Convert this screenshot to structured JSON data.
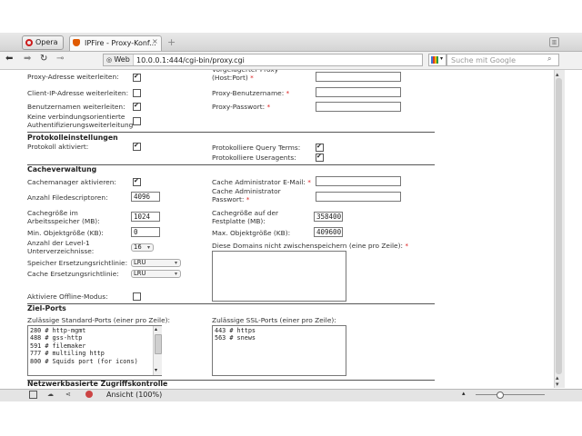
{
  "browser": {
    "opera_label": "Opera",
    "tab_title": "IPFire - Proxy-Konf...",
    "tab_close": "×",
    "new_tab": "+",
    "url_badge": "Web",
    "url": "10.0.0.1:444/cgi-bin/proxy.cgi",
    "search_placeholder": "Suche mit Google",
    "zoom_label": "Ansicht (100%)"
  },
  "form": {
    "proxy_addr_forward": "Proxy-Adresse weiterleiten:",
    "client_ip_forward": "Client-IP-Adresse weiterleiten:",
    "username_forward": "Benutzernamen weiterleiten:",
    "no_conn_auth": "Keine verbindungsorientierte Authentifizierungsweiterleitung",
    "upstream_proxy": "Vorgelagerter Proxy (Host:Port)",
    "proxy_user": "Proxy-Benutzername:",
    "proxy_pass": "Proxy-Passwort:",
    "section_log": "Protokolleinstellungen",
    "log_enabled": "Protokoll aktiviert:",
    "log_query": "Protokolliere Query Terms:",
    "log_useragents": "Protokolliere Useragents:",
    "section_cache": "Cacheverwaltung",
    "cache_manager": "Cachemanager aktivieren:",
    "cache_admin_email": "Cache Administrator E-Mail:",
    "file_descriptors": "Anzahl Filedescriptoren:",
    "file_descriptors_value": "4096",
    "cache_admin_pass": "Cache Administrator Passwort:",
    "cache_ram": "Cachegröße im Arbeitsspeicher (MB):",
    "cache_ram_value": "1024",
    "cache_disk": "Cachegröße auf der Festplatte (MB):",
    "cache_disk_value": "358400",
    "min_obj": "Min. Objektgröße (KB):",
    "min_obj_value": "0",
    "max_obj": "Max. Objektgröße (KB):",
    "max_obj_value": "409600",
    "l1_dirs": "Anzahl der Level-1 Unterverzeichnisse:",
    "l1_dirs_value": "16",
    "no_cache_domains": "Diese Domains nicht zwischenspeichern (eine pro Zeile):",
    "mem_repl": "Speicher Ersetzungsrichtlinie:",
    "mem_repl_value": "LRU",
    "cache_repl": "Cache Ersetzungsrichtlinie:",
    "cache_repl_value": "LRU",
    "offline_mode": "Aktiviere Offline-Modus:",
    "section_ports": "Ziel-Ports",
    "std_ports": "Zulässige Standard-Ports (einer pro Zeile):",
    "std_ports_value": "280 # http-mgmt\n488 # gss-http\n591 # filemaker\n777 # multiling http\n800 # Squids port (for icons)",
    "ssl_ports": "Zulässige SSL-Ports (einer pro Zeile):",
    "ssl_ports_value": "443 # https\n563 # snews",
    "section_network": "Netzwerkbasierte Zugriffskontrolle"
  },
  "icons": {
    "back": "back-arrow-icon",
    "forward": "forward-arrow-icon",
    "reload": "reload-icon",
    "key": "key-icon"
  }
}
